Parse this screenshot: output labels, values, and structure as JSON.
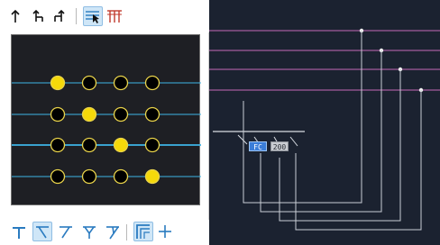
{
  "top_toolbar": {
    "buttons": [
      {
        "name": "up-arrow-icon",
        "active": false
      },
      {
        "name": "up-return-icon",
        "active": false
      },
      {
        "name": "up-double-return-icon",
        "active": false
      },
      {
        "name": "select-lines-icon",
        "active": true
      },
      {
        "name": "columns-icon",
        "active": false
      }
    ]
  },
  "preview": {
    "rows": 4,
    "cols": 4,
    "grid": [
      [
        "yellow",
        "black",
        "black",
        "black"
      ],
      [
        "black",
        "yellow",
        "black",
        "black"
      ],
      [
        "black",
        "black",
        "yellow",
        "black"
      ],
      [
        "black",
        "black",
        "black",
        "yellow"
      ]
    ],
    "colors": {
      "line": "#3fb5e6",
      "yellow": "#f5d90a",
      "black": "#000000",
      "ring": "#e8d24a",
      "highlighted_row": 2
    }
  },
  "bottom_toolbar": {
    "buttons": [
      {
        "name": "tee-down-icon",
        "active": false
      },
      {
        "name": "branch-left-icon",
        "active": true
      },
      {
        "name": "branch-right-icon",
        "active": false
      },
      {
        "name": "branch-split-icon",
        "active": false
      },
      {
        "name": "branch-merge-icon",
        "active": false
      },
      {
        "name": "frame-icon",
        "active": true
      },
      {
        "name": "plus-icon",
        "active": false
      }
    ]
  },
  "canvas": {
    "tags": [
      {
        "label": "FC"
      },
      {
        "label": "200"
      }
    ],
    "colors": {
      "background": "#1b2230",
      "bus_line": "#c66ab8",
      "wire": "#d9dde3"
    }
  }
}
